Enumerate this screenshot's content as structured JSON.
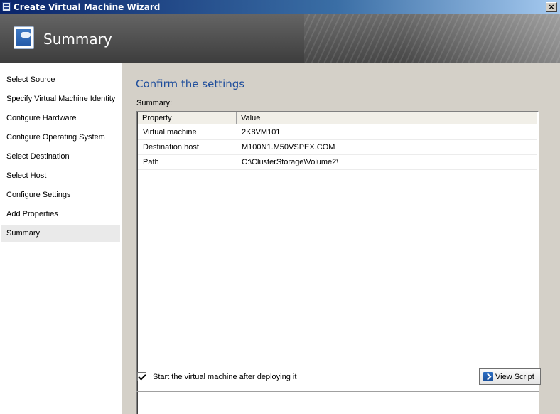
{
  "window": {
    "title": "Create Virtual Machine Wizard",
    "close_label": "×"
  },
  "banner": {
    "title": "Summary",
    "icon": "wizard-summary-icon"
  },
  "sidebar": {
    "items": [
      {
        "label": "Select Source"
      },
      {
        "label": "Specify Virtual Machine Identity"
      },
      {
        "label": "Configure Hardware"
      },
      {
        "label": "Configure Operating System"
      },
      {
        "label": "Select Destination"
      },
      {
        "label": "Select Host"
      },
      {
        "label": "Configure Settings"
      },
      {
        "label": "Add Properties"
      },
      {
        "label": "Summary",
        "active": true
      }
    ]
  },
  "main": {
    "heading": "Confirm the settings",
    "summary_label": "Summary:",
    "table": {
      "columns": [
        "Property",
        "Value"
      ],
      "rows": [
        [
          "Virtual machine",
          "2K8VM101"
        ],
        [
          "Destination host",
          "M100N1.M50VSPEX.COM"
        ],
        [
          "Path",
          "C:\\ClusterStorage\\Volume2\\"
        ]
      ]
    },
    "start_after_deploy": {
      "label": "Start the virtual machine after deploying it",
      "checked": true
    },
    "view_script_label": "View Script"
  }
}
